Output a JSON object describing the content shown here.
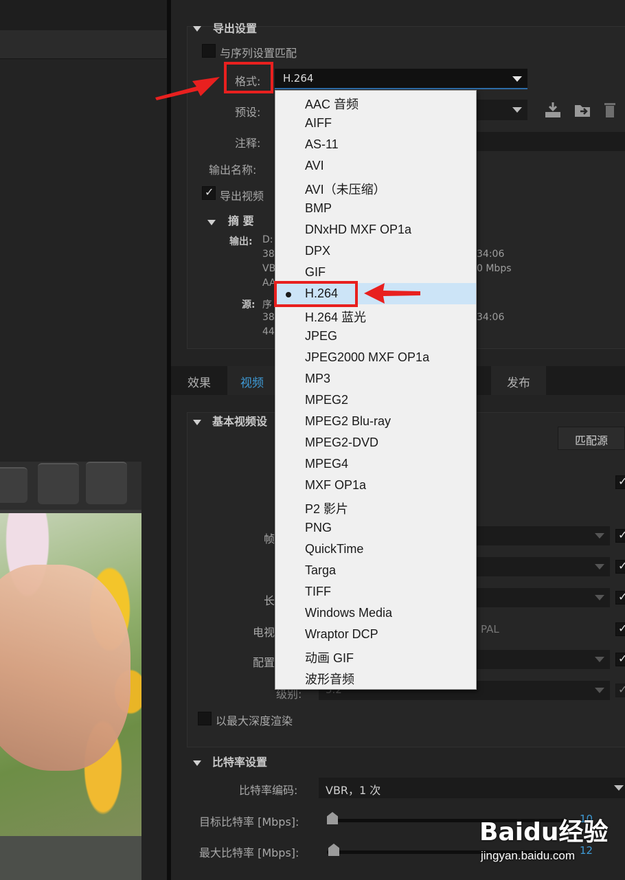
{
  "export_settings": {
    "header": "导出设置",
    "match_sequence_label": "与序列设置匹配",
    "format_label": "格式:",
    "format_value": "H.264",
    "preset_label": "预设:",
    "comments_label": "注释:",
    "output_name_label": "输出名称:",
    "export_video_label": "导出视频",
    "summary": {
      "header": "摘 要",
      "output_label": "输出:",
      "output_lines": [
        "D:",
        "38",
        "VB",
        "AA"
      ],
      "output_right": [
        "34:06",
        "0 Mbps"
      ],
      "source_label": "源:",
      "source_lines": [
        "序",
        "38",
        "44"
      ],
      "source_right": [
        "34:06"
      ]
    }
  },
  "format_options": [
    "AAC 音频",
    "AIFF",
    "AS-11",
    "AVI",
    "AVI（未压缩）",
    "BMP",
    "DNxHD MXF OP1a",
    "DPX",
    "GIF",
    "H.264",
    "H.264 蓝光",
    "JPEG",
    "JPEG2000 MXF OP1a",
    "MP3",
    "MPEG2",
    "MPEG2 Blu-ray",
    "MPEG2-DVD",
    "MPEG4",
    "MXF OP1a",
    "P2 影片",
    "PNG",
    "QuickTime",
    "Targa",
    "TIFF",
    "Windows Media",
    "Wraptor DCP",
    "动画 GIF",
    "波形音频"
  ],
  "selected_format_index": 9,
  "tabs": {
    "effects": "效果",
    "video": "视频",
    "publish": "发布"
  },
  "basic_video": {
    "header": "基本视频设",
    "match_source_button": "匹配源",
    "row_labels": [
      "帧",
      "长",
      "电视",
      "配置",
      "级别:"
    ],
    "tv_value": "PAL",
    "level_value": "5.2",
    "render_max_depth": "以最大深度渲染"
  },
  "bitrate": {
    "header": "比特率设置",
    "encoding_label": "比特率编码:",
    "encoding_value": "VBR，1 次",
    "target_label": "目标比特率 [Mbps]:",
    "target_value": "10",
    "max_label": "最大比特率 [Mbps]:",
    "max_value": "12"
  },
  "watermark": {
    "logo": "Baidu经验",
    "url": "jingyan.baidu.com"
  },
  "colors": {
    "accent": "#3e9ad6",
    "annotation_red": "#e8201f",
    "dropdown_bg": "#f0f0f0",
    "selection": "#cce4f7"
  }
}
